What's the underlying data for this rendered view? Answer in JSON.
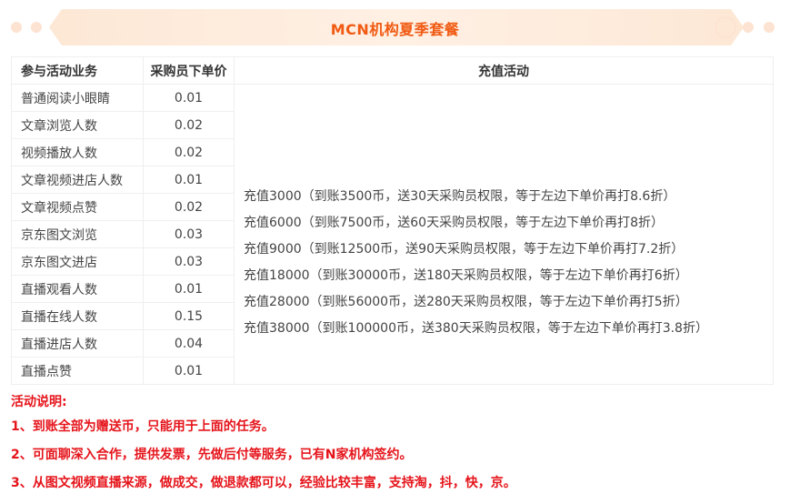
{
  "header": {
    "title": "MCN机构夏季套餐"
  },
  "table": {
    "headers": {
      "business": "参与活动业务",
      "price": "采购员下单价",
      "recharge": "充值活动"
    },
    "rows": [
      {
        "business": "普通阅读小眼睛",
        "price": "0.01"
      },
      {
        "business": "文章浏览人数",
        "price": "0.02"
      },
      {
        "business": "视频播放人数",
        "price": "0.02"
      },
      {
        "business": "文章视频进店人数",
        "price": "0.01"
      },
      {
        "business": "文章视频点赞",
        "price": "0.02"
      },
      {
        "business": "京东图文浏览",
        "price": "0.03"
      },
      {
        "business": "京东图文进店",
        "price": "0.03"
      },
      {
        "business": "直播观看人数",
        "price": "0.01"
      },
      {
        "business": "直播在线人数",
        "price": "0.15"
      },
      {
        "business": "直播进店人数",
        "price": "0.04"
      },
      {
        "business": "直播点赞",
        "price": "0.01"
      }
    ],
    "recharge_lines": [
      "充值3000（到账3500币，送30天采购员权限，等于左边下单价再打8.6折）",
      "充值6000（到账7500币，送60天采购员权限，等于左边下单价再打8折）",
      "充值9000（到账12500币，送90天采购员权限，等于左边下单价再打7.2折）",
      "充值18000（到账30000币，送180天采购员权限，等于左边下单价再打6折）",
      "充值28000（到账56000币，送280天采购员权限，等于左边下单价再打5折）",
      "充值38000（到账100000币，送380天采购员权限，等于左边下单价再打3.8折）"
    ]
  },
  "notes": {
    "title": "活动说明:",
    "items": [
      "1、到账全部为赠送币，只能用于上面的任务。",
      "2、可面聊深入合作，提供发票，先做后付等服务，已有N家机构签约。",
      "3、从图文视频直播来源，做成交，做退款都可以，经验比较丰富，支持淘，抖，快，京。"
    ]
  },
  "colors": {
    "accent": "#f05a12",
    "note_red": "#e5141b",
    "ribbon": "#fde8d6"
  }
}
